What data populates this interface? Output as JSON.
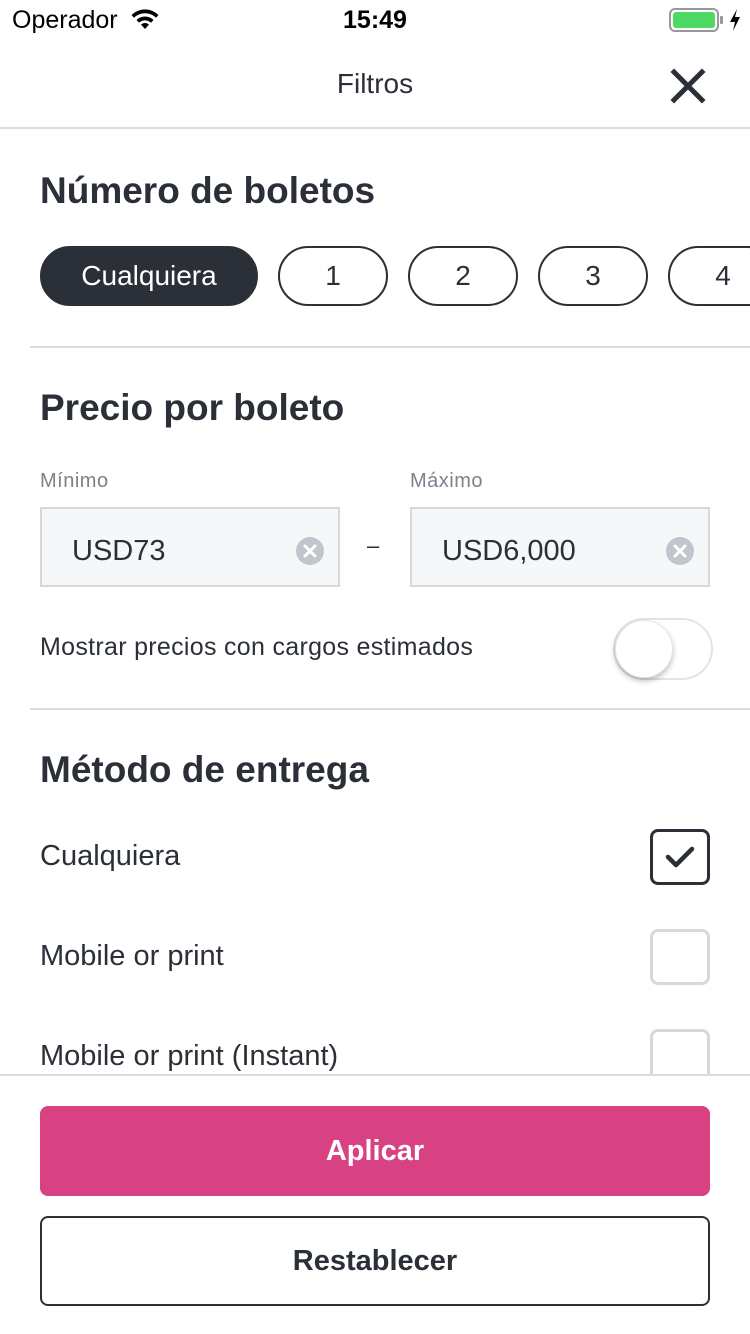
{
  "status_bar": {
    "carrier": "Operador",
    "time": "15:49",
    "icons": [
      "wifi-icon",
      "battery-icon",
      "charging-bolt-icon"
    ],
    "battery_color": "#4cd964"
  },
  "header": {
    "title": "Filtros",
    "close_icon": "close-icon"
  },
  "tickets": {
    "title": "Número de boletos",
    "options": [
      "Cualquiera",
      "1",
      "2",
      "3",
      "4"
    ],
    "selected": "Cualquiera"
  },
  "price": {
    "title": "Precio por boleto",
    "min_label": "Mínimo",
    "min_value": "USD73",
    "max_label": "Máximo",
    "max_value": "USD6,000",
    "separator": "–",
    "toggle_label": "Mostrar precios con cargos estimados",
    "toggle_on": false
  },
  "delivery": {
    "title": "Método de entrega",
    "options": [
      {
        "label": "Cualquiera",
        "checked": true
      },
      {
        "label": "Mobile or print",
        "checked": false
      },
      {
        "label": "Mobile or print (Instant)",
        "checked": false
      }
    ]
  },
  "actions": {
    "apply_label": "Aplicar",
    "reset_label": "Restablecer"
  },
  "colors": {
    "accent": "#d84182",
    "text": "#2b3038",
    "divider": "#dcdcdc"
  }
}
